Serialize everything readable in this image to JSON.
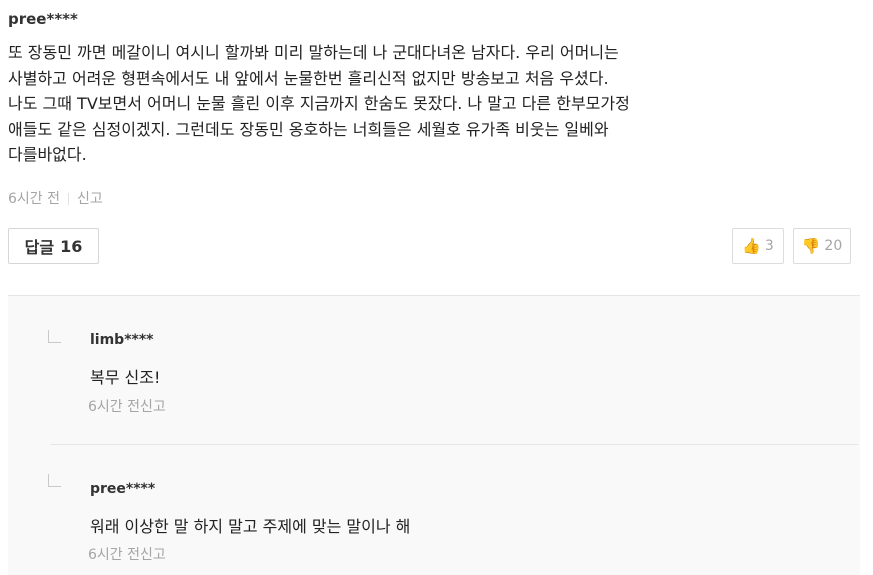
{
  "main_comment": {
    "author": "pree****",
    "text": "또 장동민 까면 메갈이니 여시니 할까봐 미리 말하는데 나 군대다녀온 남자다. 우리 어머니는\n사별하고 어려운 형편속에서도 내 앞에서 눈물한번 흘리신적 없지만 방송보고 처음 우셨다.\n나도 그때 TV보면서 어머니 눈물 흘린 이후 지금까지 한숨도 못잤다. 나 말고 다른 한부모가정\n애들도 같은 심정이겠지. 그런데도 장동민 옹호하는 너희들은 세월호 유가족 비웃는 일베와\n다를바없다.",
    "time": "6시간 전",
    "report": "신고"
  },
  "actions": {
    "reply_label": "답글",
    "reply_count": "16",
    "upvotes": "3",
    "downvotes": "20"
  },
  "replies": [
    {
      "author": "limb****",
      "text": "복무 신조!",
      "time": "6시간 전",
      "report": "신고"
    },
    {
      "author": "pree****",
      "text": "워래 이상한 말 하지 말고 주제에 맞는 말이나 해",
      "time": "6시간 전",
      "report": "신고"
    }
  ]
}
